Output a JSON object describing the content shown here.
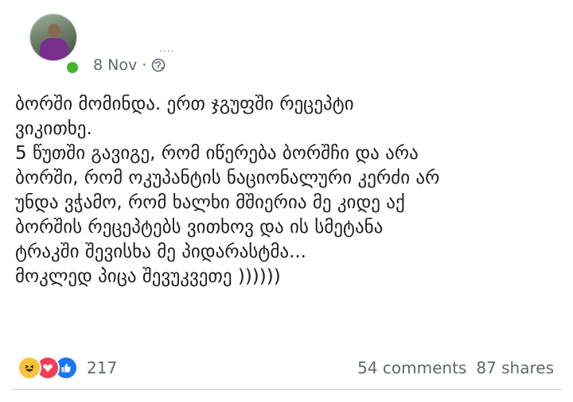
{
  "post": {
    "timestamp": "8 Nov",
    "separator": "·",
    "privacy_icon": "globe-icon",
    "lines": [
      "ბორში მომინდა. ერთ ჯგუფში რეცეპტი",
      "ვიკითხე.",
      "5 წუთში გავიგე, რომ იწერება ბორშჩი და არა",
      "ბორში, რომ ოკუპანტის ნაციონალური კერძი არ",
      "უნდა ვჭამო, რომ ხალხი მშიერია მე კიდე აქ",
      "ბორშის რეცეპტებს ვითხოვ და ის სმეტანა",
      "ტრაკში შევისხა მე პიდარასტმა...",
      "მოკლედ პიცა შევუკვეთე ))))))"
    ]
  },
  "reactions": {
    "icons": [
      "haha-icon",
      "love-icon",
      "like-icon"
    ],
    "count": "217"
  },
  "stats": {
    "comments": "54 comments",
    "shares": "87 shares"
  },
  "colors": {
    "text": "#1c1e21",
    "meta": "#606770",
    "online": "#42b72a",
    "like": "#1877f2",
    "love": "#f33e58",
    "haha": "#f7c33c"
  }
}
